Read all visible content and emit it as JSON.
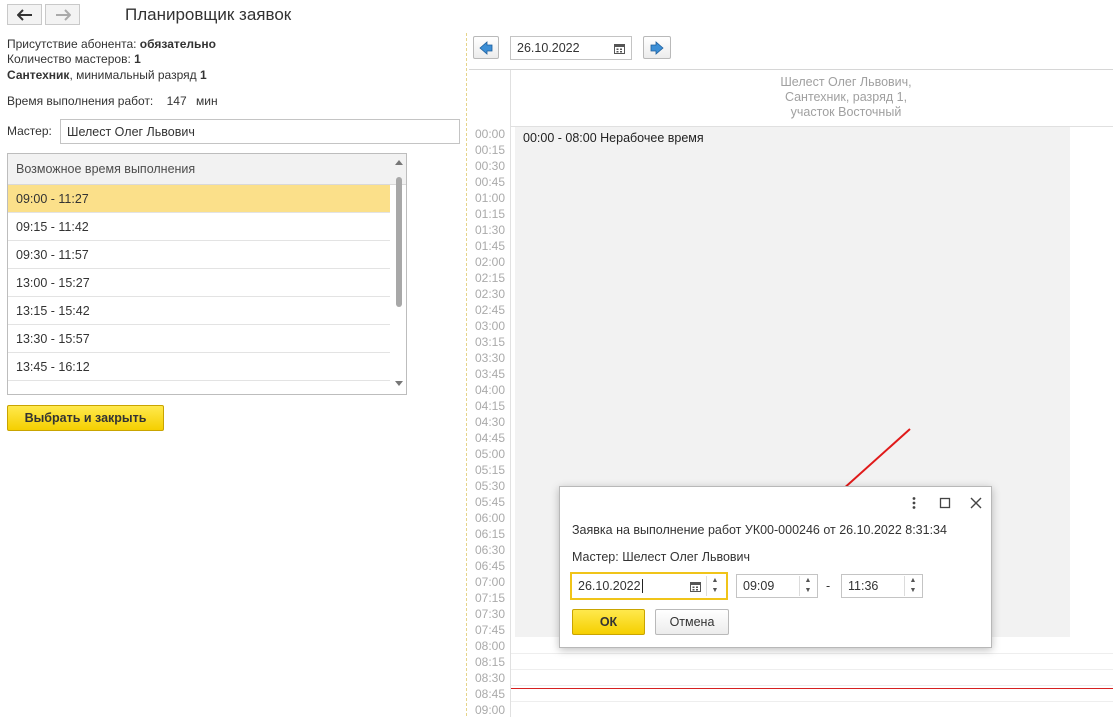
{
  "window": {
    "title": "Планировщик заявок"
  },
  "info": {
    "presence_label": "Присутствие абонента: ",
    "presence_value": "обязательно",
    "masters_count_label": "Количество мастеров: ",
    "masters_count_value": "1",
    "specialty": "Сантехник",
    "specialty_suffix": ", минимальный разряд ",
    "min_grade": "1",
    "duration_label": "Время выполнения работ:",
    "duration_value": "147",
    "duration_unit": "мин",
    "master_label": "Мастер:",
    "master_value": "Шелест Олег Львович"
  },
  "slots_list": {
    "header": "Возможное время выполнения",
    "items": [
      "09:00 - 11:27",
      "09:15 - 11:42",
      "09:30 - 11:57",
      "13:00 - 15:27",
      "13:15 - 15:42",
      "13:30 - 15:57",
      "13:45 - 16:12"
    ],
    "selected_index": 0
  },
  "select_button": "Выбрать и закрыть",
  "calendar": {
    "date": "26.10.2022",
    "header_lines": [
      "Шелест Олег Львович,",
      "Сантехник, разряд 1,",
      "участок Восточный"
    ],
    "times": [
      "00:00",
      "00:15",
      "00:30",
      "00:45",
      "01:00",
      "01:15",
      "01:30",
      "01:45",
      "02:00",
      "02:15",
      "02:30",
      "02:45",
      "03:00",
      "03:15",
      "03:30",
      "03:45",
      "04:00",
      "04:15",
      "04:30",
      "04:45",
      "05:00",
      "05:15",
      "05:30",
      "05:45",
      "06:00",
      "06:15",
      "06:30",
      "06:45",
      "07:00",
      "07:15",
      "07:30",
      "07:45",
      "08:00",
      "08:15",
      "08:30",
      "08:45",
      "09:00"
    ],
    "nonwork_label": "00:00 - 08:00 Нерабочее время",
    "accent_color": "#d62020"
  },
  "dialog": {
    "title_text": "Заявка на выполнение работ УК00-000246 от 26.10.2022 8:31:34",
    "master_text": "Мастер: Шелест Олег Львович",
    "date_value": "26.10.2022",
    "time_from": "09:09",
    "time_sep": "-",
    "time_to": "11:36",
    "ok_label": "ОК",
    "cancel_label": "Отмена"
  },
  "icons": {
    "back": "back-arrow-icon",
    "forward": "forward-arrow-icon",
    "calendar": "calendar-icon",
    "prev": "prev-day-icon",
    "next": "next-day-icon",
    "more": "more-icon",
    "maximize": "maximize-icon",
    "close": "close-icon"
  }
}
